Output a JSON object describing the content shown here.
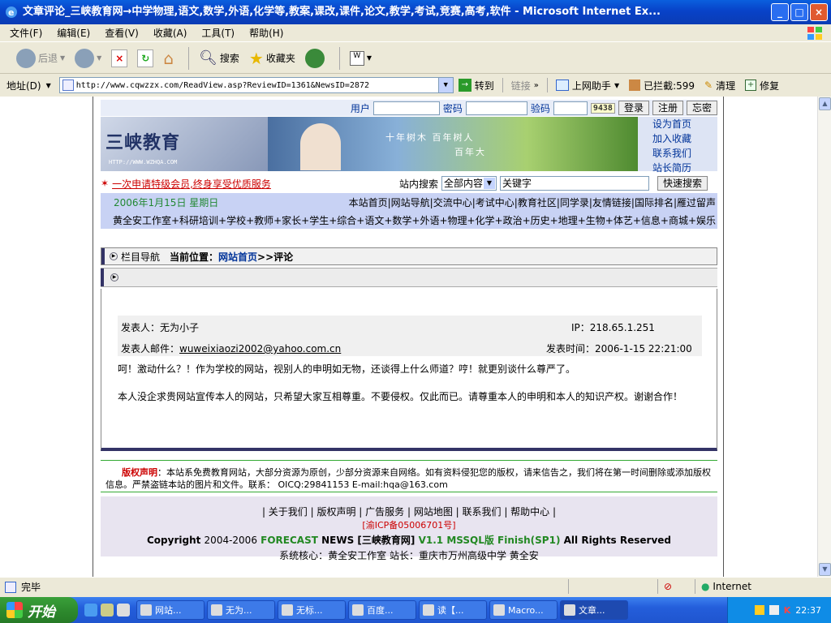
{
  "window": {
    "title": "文章评论_三峡教育网→中学物理,语文,数学,外语,化学等,教案,课改,课件,论文,教学,考试,竞赛,高考,软件 - Microsoft Internet Ex...",
    "buttons": {
      "minimize": "_",
      "maximize": "□",
      "close": "×"
    }
  },
  "menu": [
    "文件(F)",
    "编辑(E)",
    "查看(V)",
    "收藏(A)",
    "工具(T)",
    "帮助(H)"
  ],
  "toolbar": {
    "back": "后退",
    "search": "搜索",
    "favorites": "收藏夹"
  },
  "address": {
    "label": "地址(D)",
    "url": "http://www.cqwzzx.com/ReadView.asp?ReviewID=1361&NewsID=2872",
    "go": "转到",
    "links": "链接",
    "assistant": "上网助手",
    "blocked": "已拦截:599",
    "clean": "清理",
    "repair": "修复"
  },
  "login": {
    "user_label": "用户",
    "password_label": "密码",
    "captcha_label": "验码",
    "captcha": "9438",
    "login_button": "登录",
    "register_button": "注册",
    "forgot_button": "忘密"
  },
  "banner": {
    "logo_text": "三峡教育",
    "logo_url": "HTTP://WWW.WZHQA.COM",
    "slogan1": "十年树木 百年树人",
    "slogan2": "百年大"
  },
  "side_links": [
    "设为首页",
    "加入收藏",
    "联系我们",
    "站长简历"
  ],
  "vip": {
    "text": "一次申请特级会员,终身享受优质服务"
  },
  "site_search": {
    "label": "站内搜索",
    "scope": "全部内容",
    "keyword": "关键字",
    "button": "快速搜索"
  },
  "nav": {
    "date": "2006年1月15日 星期日",
    "links": "本站首页|网站导航|交流中心|考试中心|教育社区|同学录|友情链接|国际排名|雁过留声",
    "categories": "黄全安工作室+科研培训+学校+教师+家长+学生+综合+语文+数学+外语+物理+化学+政治+历史+地理+生物+体艺+信息+商城+娱乐"
  },
  "breadcrumb": {
    "nav_label": "栏目导航",
    "current_label": "当前位置：",
    "home": "网站首页",
    "current": ">>评论"
  },
  "review": {
    "poster": "发表人：无为小子",
    "ip": "IP：218.65.1.251",
    "email_label": "发表人邮件：",
    "email": "wuweixiaozi2002@yahoo.com.cn",
    "time": "发表时间：2006-1-15 22:21:00",
    "text1": "呵！激动什么？！作为学校的网站，视别人的申明如无物，还谈得上什么师道？哼！就更别谈什么尊严了。",
    "text2": "本人没企求贵网站宣传本人的网站，只希望大家互相尊重。不要侵权。仅此而已。请尊重本人的申明和本人的知识产权。谢谢合作！"
  },
  "copyright": {
    "title": "版权声明",
    "text": "：本站系免费教育网站，大部分资源为原创，少部分资源来自网络。如有资料侵犯您的版权，请来信告之，我们将在第一时间删除或添加版权信息。严禁盗链本站的图片和文件。联系：  OICQ:29841153         E-mail:hqa@163.com"
  },
  "footer": {
    "links": "| 关于我们 | 版权声明 | 广告服务 | 网站地图 | 联系我们 | 帮助中心 |",
    "icp": "[渝ICP备05006701号]",
    "copy_prefix": "Copyright",
    "copy_years": "2004-2006",
    "forecast": "FORECAST",
    "news": "NEWS",
    "site": "[三峡教育网]",
    "version": "V1.1 MSSQL版 Finish(SP1)",
    "rights": "All Rights Reserved",
    "core": "系统核心：黄全安工作室  站长：重庆市万州高级中学  黄全安"
  },
  "status": {
    "text": "完毕",
    "zone": "Internet"
  },
  "taskbar": {
    "start": "开始",
    "tasks": [
      "网站...",
      "无为...",
      "无标...",
      "百度...",
      "读【...",
      "Macro...",
      "文章..."
    ],
    "clock": "22:37"
  }
}
